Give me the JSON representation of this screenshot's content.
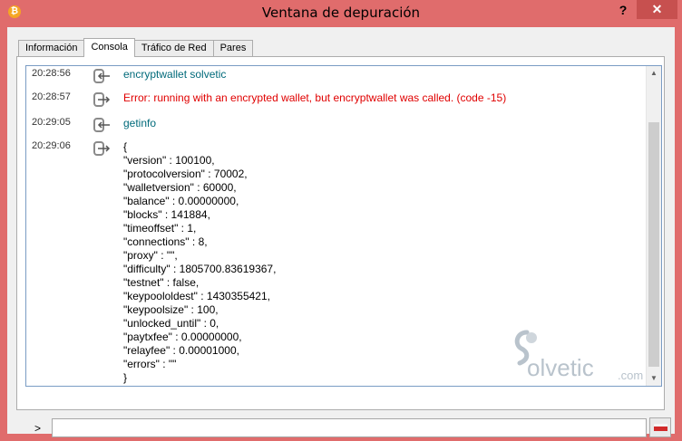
{
  "window": {
    "title": "Ventana de depuración",
    "icon": "bitcoin-icon",
    "icon_glyph": "₿",
    "help_label": "?",
    "close_label": "✕"
  },
  "tabs": [
    {
      "label": "Información",
      "active": false
    },
    {
      "label": "Consola",
      "active": true
    },
    {
      "label": "Tráfico de Red",
      "active": false
    },
    {
      "label": "Pares",
      "active": false
    }
  ],
  "console": {
    "entries": [
      {
        "time": "20:28:56",
        "direction": "input",
        "text": "encryptwallet solvetic"
      },
      {
        "time": "20:28:57",
        "direction": "output",
        "text": "Error: running with an encrypted wallet, but encryptwallet was called. (code -15)"
      },
      {
        "time": "20:29:05",
        "direction": "input",
        "text": "getinfo"
      },
      {
        "time": "20:29:06",
        "direction": "output",
        "text": "{\n\"version\" : 100100,\n\"protocolversion\" : 70002,\n\"walletversion\" : 60000,\n\"balance\" : 0.00000000,\n\"blocks\" : 141884,\n\"timeoffset\" : 1,\n\"connections\" : 8,\n\"proxy\" : \"\",\n\"difficulty\" : 1805700.83619367,\n\"testnet\" : false,\n\"keypoololdest\" : 1430355421,\n\"keypoolsize\" : 100,\n\"unlocked_until\" : 0,\n\"paytxfee\" : 0.00000000,\n\"relayfee\" : 0.00001000,\n\"errors\" : \"\"\n}"
      }
    ]
  },
  "watermark": {
    "text": "olvetic",
    "suffix": ".com"
  },
  "prompt": {
    "symbol": ">",
    "value": ""
  },
  "colors": {
    "titlebar": "#e06c6c",
    "close": "#c7504f",
    "command_text": "#006a7a",
    "error_text": "#e00000"
  }
}
